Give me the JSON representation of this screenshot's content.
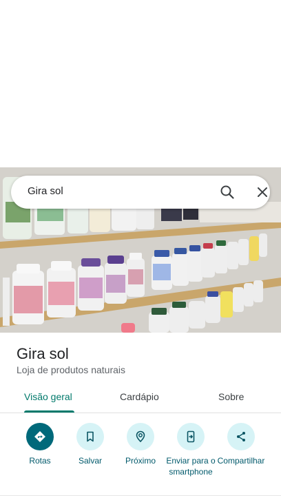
{
  "search": {
    "query": "Gira sol"
  },
  "place": {
    "title": "Gira sol",
    "category": "Loja de produtos naturais"
  },
  "tabs": [
    {
      "label": "Visão geral",
      "active": true
    },
    {
      "label": "Cardápio",
      "active": false
    },
    {
      "label": "Sobre",
      "active": false
    }
  ],
  "actions": [
    {
      "label": "Rotas",
      "icon": "directions-icon"
    },
    {
      "label": "Salvar",
      "icon": "bookmark-icon"
    },
    {
      "label": "Próximo",
      "icon": "nearby-icon"
    },
    {
      "label": "Enviar para o smartphone",
      "icon": "send-to-phone-icon"
    },
    {
      "label": "Compartilhar",
      "icon": "share-icon"
    }
  ],
  "colors": {
    "accent": "#00796b",
    "action_bg": "#d6f3f6",
    "primary_action_bg": "#00697a"
  }
}
